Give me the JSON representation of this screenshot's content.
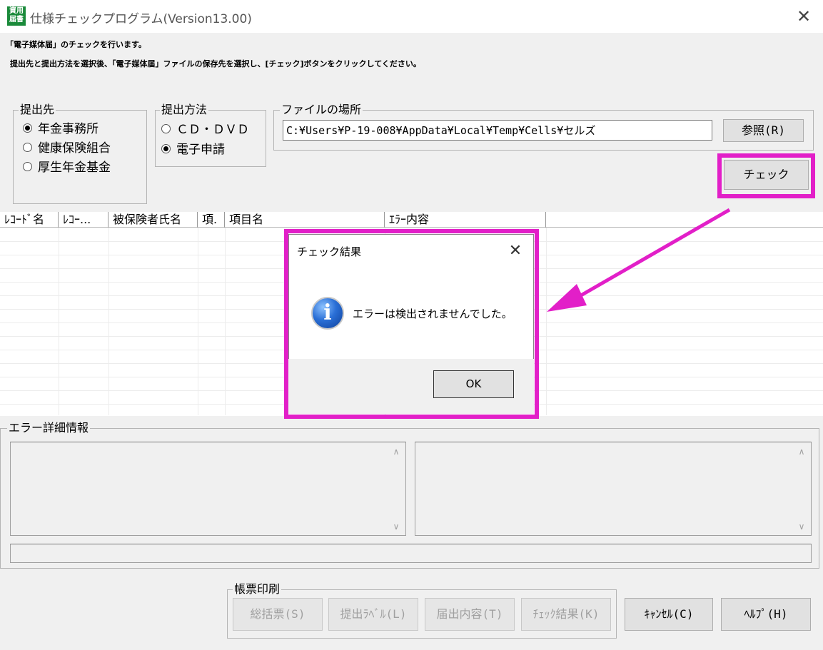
{
  "window": {
    "icon_text": "資用\n届書",
    "title": "仕様チェックプログラム(Version13.00)",
    "close_glyph": "✕"
  },
  "instructions": {
    "line1": "「電子媒体届」のチェックを行います。",
    "line2": "提出先と提出方法を選択後、「電子媒体届」ファイルの保存先を選択し、[チェック]ボタンをクリックしてください。"
  },
  "submit_to": {
    "label": "提出先",
    "options": [
      {
        "label": "年金事務所",
        "selected": true
      },
      {
        "label": "健康保険組合",
        "selected": false
      },
      {
        "label": "厚生年金基金",
        "selected": false
      }
    ]
  },
  "submit_method": {
    "label": "提出方法",
    "options": [
      {
        "label": "ＣＤ・ＤＶＤ",
        "selected": false
      },
      {
        "label": "電子申請",
        "selected": true
      }
    ]
  },
  "file_location": {
    "label": "ファイルの場所",
    "value": "C:¥Users¥P-19-008¥AppData¥Local¥Temp¥Cells¥セルズ",
    "browse_label": "参照(R)"
  },
  "check_button_label": "チェック",
  "grid": {
    "columns": [
      "ﾚｺｰﾄﾞ名",
      "ﾚｺｰ...",
      "被保険者氏名",
      "項.",
      "項目名",
      "ｴﾗｰ内容"
    ]
  },
  "error_detail": {
    "label": "エラー詳細情報",
    "scroll_up": "∧",
    "scroll_down": "∨"
  },
  "print_group": {
    "label": "帳票印刷",
    "buttons": [
      "総括票(S)",
      "提出ﾗﾍﾞﾙ(L)",
      "届出内容(T)",
      "ﾁｪｯｸ結果(K)"
    ]
  },
  "cancel_label": "ｷｬﾝｾﾙ(C)",
  "help_label": "ﾍﾙﾌﾟ(H)",
  "dialog": {
    "title": "チェック結果",
    "close_glyph": "✕",
    "icon_glyph": "i",
    "message": "エラーは検出されませんでした。",
    "ok_label": "OK"
  },
  "colors": {
    "highlight": "#e21fc8",
    "app_icon": "#1a8a3a"
  }
}
